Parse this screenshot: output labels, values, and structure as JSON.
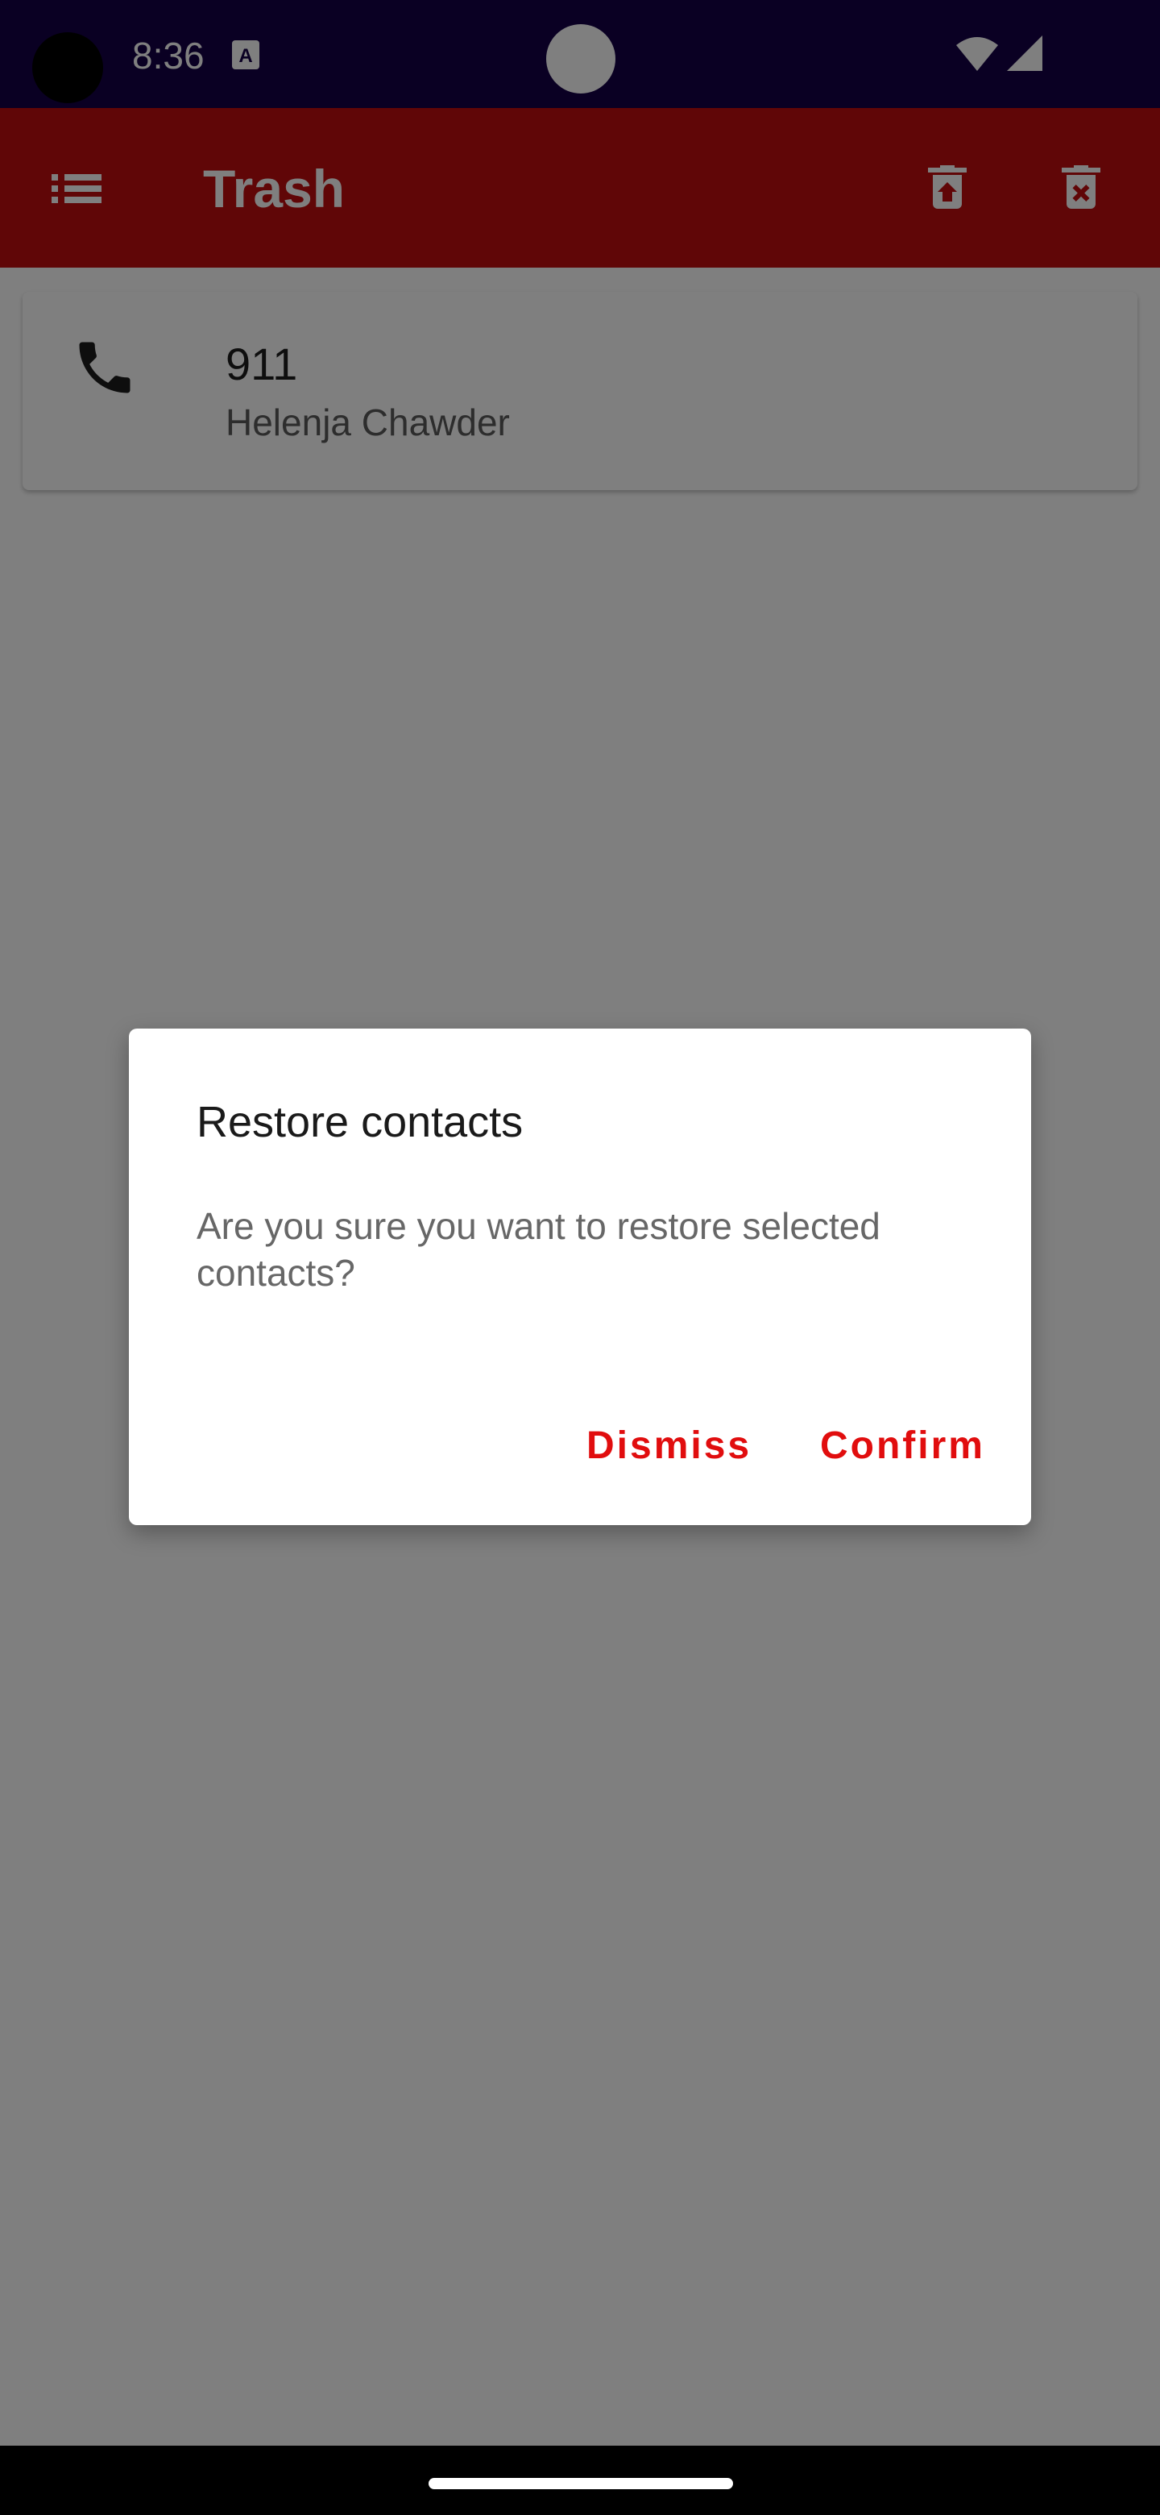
{
  "status_bar": {
    "time": "8:36",
    "icons": [
      "camera-cutout",
      "accessibility-a-icon",
      "status-dot",
      "wifi-icon",
      "signal-icon"
    ]
  },
  "app_bar": {
    "title": "Trash",
    "background_color": "#c00d0e",
    "icons": [
      "menu-icon",
      "restore-icon",
      "delete-forever-icon"
    ]
  },
  "contacts": [
    {
      "number": "911",
      "name": "Helenja Chawder",
      "icon": "phone-icon"
    }
  ],
  "dialog": {
    "title": "Restore contacts",
    "message": "Are you sure you want to restore selected contacts?",
    "dismiss_label": "Dismiss",
    "confirm_label": "Confirm",
    "accent_color": "#e10d0e"
  },
  "colors": {
    "status_bar": "#150047",
    "scrim": "rgba(0,0,0,0.5)"
  }
}
